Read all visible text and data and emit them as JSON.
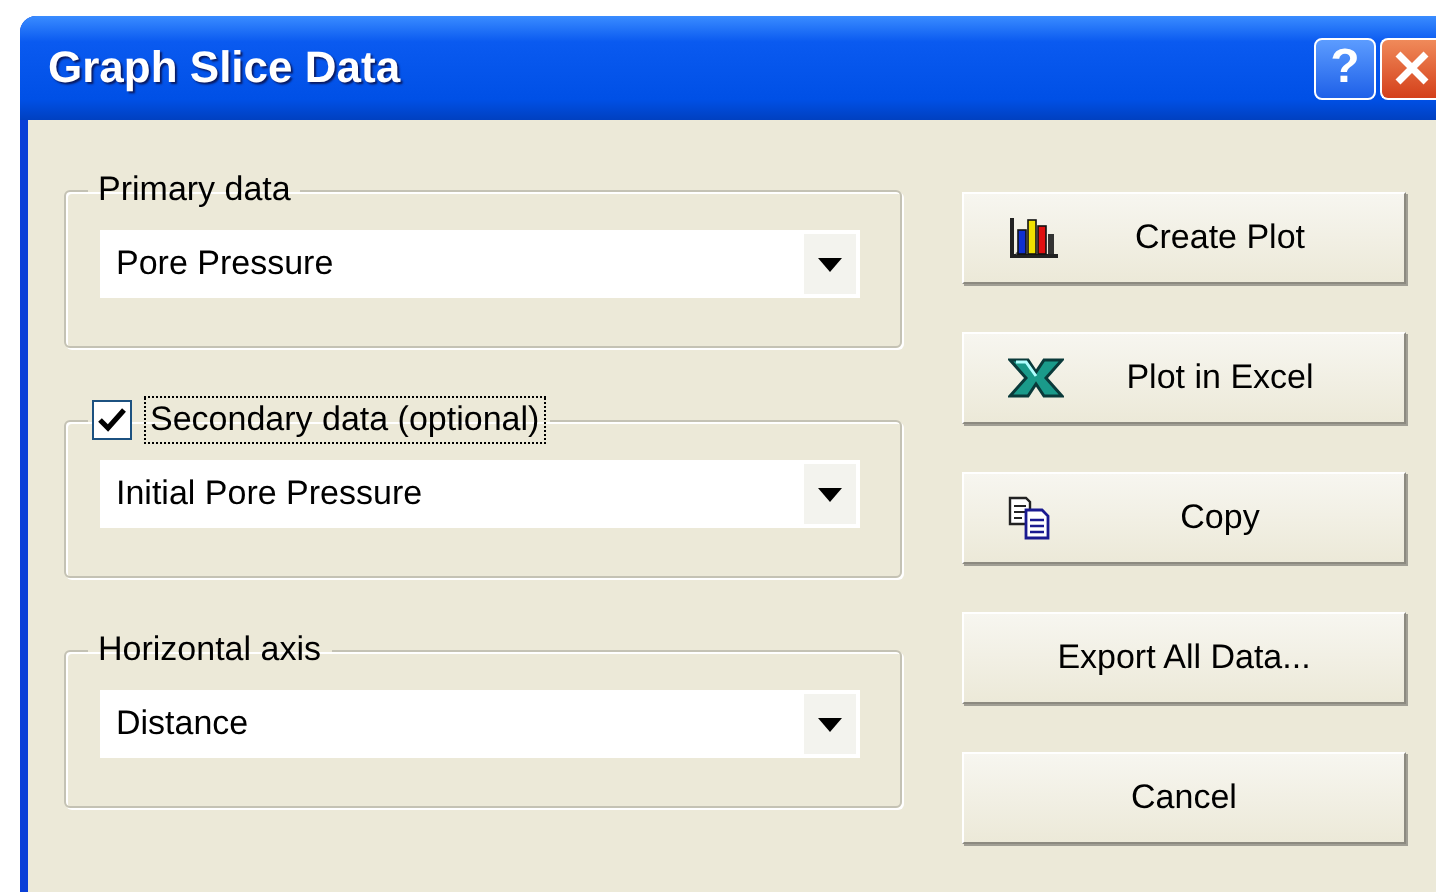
{
  "window": {
    "title": "Graph Slice Data",
    "help_button": "?"
  },
  "groups": [
    {
      "kind": "plain",
      "label": "Primary data",
      "value": "Pore Pressure"
    },
    {
      "kind": "checkbox",
      "label": "Secondary data (optional)",
      "checked": true,
      "focused": true,
      "value": "Initial Pore Pressure"
    },
    {
      "kind": "plain",
      "label": "Horizontal axis",
      "value": "Distance"
    }
  ],
  "buttons": [
    {
      "kind": "chart",
      "label": "Create Plot"
    },
    {
      "kind": "excel",
      "label": "Plot in Excel"
    },
    {
      "kind": "copy",
      "label": "Copy"
    },
    {
      "kind": "text",
      "label": "Export All Data..."
    },
    {
      "kind": "text",
      "label": "Cancel"
    }
  ]
}
